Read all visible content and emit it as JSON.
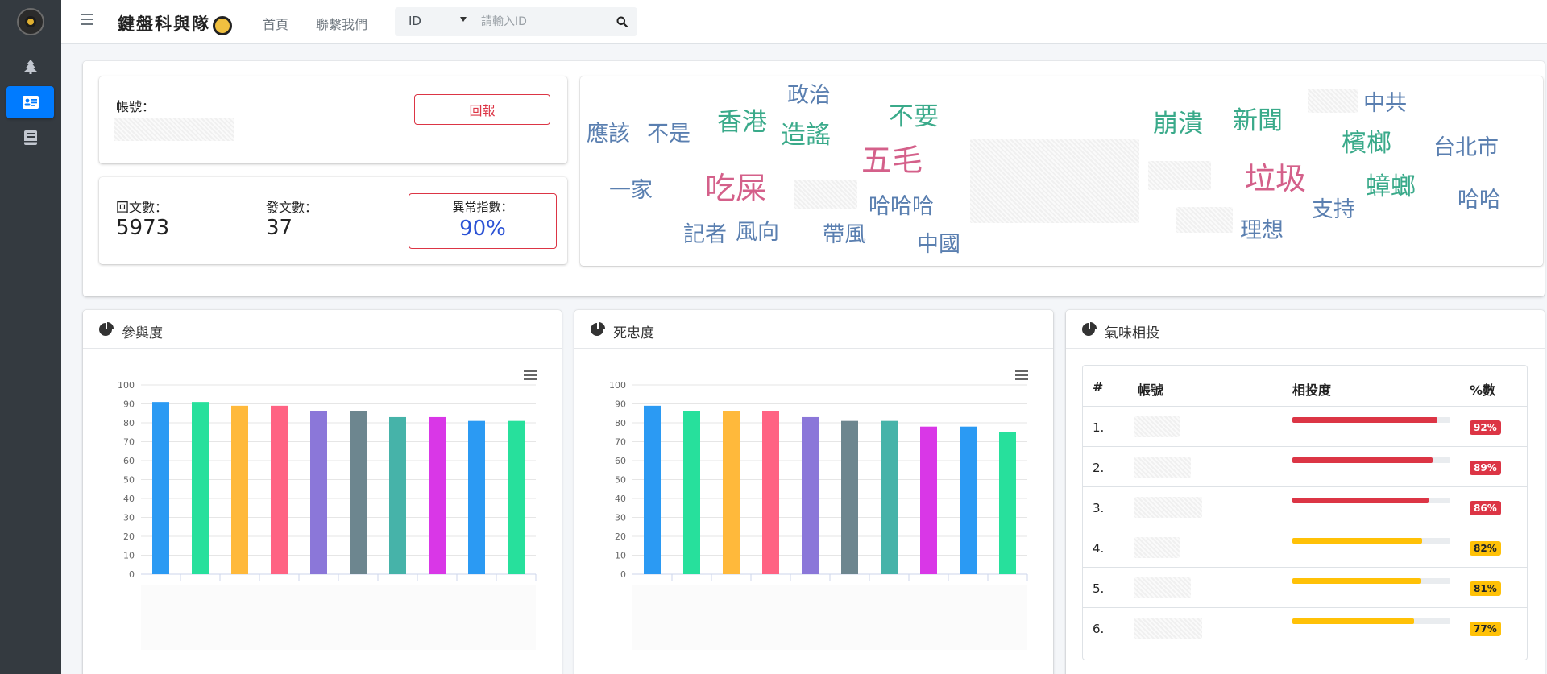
{
  "brand": {
    "title": "鍵盤科與隊"
  },
  "nav": {
    "home": "首頁",
    "contact": "聯繫我們"
  },
  "search": {
    "select_value": "ID",
    "placeholder": "請輸入ID"
  },
  "profile": {
    "account_label": "帳號：",
    "report_label": "回報"
  },
  "stats": {
    "replies_label": "回文數：",
    "replies_value": "5973",
    "posts_label": "發文數：",
    "posts_value": "37",
    "anomaly_label": "異常指數：",
    "anomaly_value": "90%",
    "anomaly_color": "#2b52d5",
    "alert_color": "#dc3545"
  },
  "word_cloud": [
    {
      "text": "應該",
      "color": "#5a7fb0"
    },
    {
      "text": "不是",
      "color": "#5a7fb0"
    },
    {
      "text": "香港",
      "color": "#3aaa8a"
    },
    {
      "text": "政治",
      "color": "#5a7fb0"
    },
    {
      "text": "造謠",
      "color": "#3aaa8a"
    },
    {
      "text": "不要",
      "color": "#3aaa8a"
    },
    {
      "text": "五毛",
      "color": "#d4608a"
    },
    {
      "text": "一家",
      "color": "#5a7fb0"
    },
    {
      "text": "吃屎",
      "color": "#d4608a"
    },
    {
      "text": "哈哈哈",
      "color": "#5a7fb0"
    },
    {
      "text": "記者",
      "color": "#5a7fb0"
    },
    {
      "text": "風向",
      "color": "#5a7fb0"
    },
    {
      "text": "帶風",
      "color": "#5a7fb0"
    },
    {
      "text": "中國",
      "color": "#5a7fb0"
    },
    {
      "text": "崩潰",
      "color": "#3aaa8a"
    },
    {
      "text": "新聞",
      "color": "#3aaa8a"
    },
    {
      "text": "中共",
      "color": "#5a7fb0"
    },
    {
      "text": "檳榔",
      "color": "#3aaa8a"
    },
    {
      "text": "台北市",
      "color": "#5a7fb0"
    },
    {
      "text": "垃圾",
      "color": "#d4608a"
    },
    {
      "text": "蟑螂",
      "color": "#3aaa8a"
    },
    {
      "text": "哈哈",
      "color": "#5a7fb0"
    },
    {
      "text": "支持",
      "color": "#5a7fb0"
    },
    {
      "text": "理想",
      "color": "#5a7fb0"
    }
  ],
  "cards": {
    "participation": "參與度",
    "loyalty": "死忠度",
    "similarity": "氣味相投"
  },
  "chart_data": [
    {
      "type": "bar",
      "title": "參與度",
      "categories": [
        "",
        "",
        "",
        "",
        "",
        "",
        "",
        "",
        "",
        ""
      ],
      "values": [
        91,
        91,
        89,
        89,
        86,
        86,
        83,
        83,
        81,
        81
      ],
      "colors": [
        "#2b9af3",
        "#27e09c",
        "#ffb93b",
        "#ff6383",
        "#8b77d9",
        "#6d868f",
        "#46b3a9",
        "#d937e7",
        "#2b9af3",
        "#27e09c"
      ],
      "ylim": [
        0,
        100
      ],
      "yticks": [
        0,
        10,
        20,
        30,
        40,
        50,
        60,
        70,
        80,
        90,
        100
      ],
      "grid": true
    },
    {
      "type": "bar",
      "title": "死忠度",
      "categories": [
        "",
        "",
        "",
        "",
        "",
        "",
        "",
        "",
        "",
        ""
      ],
      "values": [
        89,
        86,
        86,
        86,
        83,
        81,
        81,
        78,
        78,
        75
      ],
      "colors": [
        "#2b9af3",
        "#27e09c",
        "#ffb93b",
        "#ff6383",
        "#8b77d9",
        "#6d868f",
        "#46b3a9",
        "#d937e7",
        "#2b9af3",
        "#27e09c"
      ],
      "ylim": [
        0,
        100
      ],
      "yticks": [
        0,
        10,
        20,
        30,
        40,
        50,
        60,
        70,
        80,
        90,
        100
      ],
      "grid": true
    }
  ],
  "table": {
    "headers": [
      "#",
      "帳號",
      "相投度",
      "%數"
    ],
    "rows": [
      {
        "rank": "1.",
        "percent": "92%",
        "value": 0.92,
        "color": "#dc3545",
        "text_color": "#ffffff"
      },
      {
        "rank": "2.",
        "percent": "89%",
        "value": 0.89,
        "color": "#dc3545",
        "text_color": "#ffffff"
      },
      {
        "rank": "3.",
        "percent": "86%",
        "value": 0.86,
        "color": "#dc3545",
        "text_color": "#ffffff"
      },
      {
        "rank": "4.",
        "percent": "82%",
        "value": 0.82,
        "color": "#ffc107",
        "text_color": "#212529"
      },
      {
        "rank": "5.",
        "percent": "81%",
        "value": 0.81,
        "color": "#ffc107",
        "text_color": "#212529"
      },
      {
        "rank": "6.",
        "percent": "77%",
        "value": 0.77,
        "color": "#ffc107",
        "text_color": "#212529"
      }
    ]
  }
}
